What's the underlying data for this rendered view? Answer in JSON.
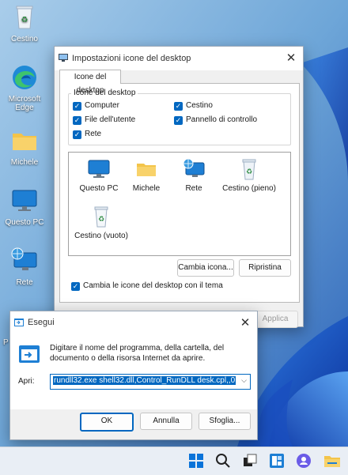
{
  "colors": {
    "accent": "#0067c0",
    "desktop_bg": "#7fb0da",
    "taskbar_bg": "#e9eef5"
  },
  "desktop": {
    "icons": [
      {
        "label": "Cestino",
        "icon": "recycle-bin-icon"
      },
      {
        "label": "Microsoft Edge",
        "icon": "edge-icon"
      },
      {
        "label": "Michele",
        "icon": "user-folder-icon"
      },
      {
        "label": "Questo PC",
        "icon": "computer-icon"
      },
      {
        "label": "Rete",
        "icon": "network-icon"
      },
      {
        "label": "P",
        "icon": "partial-icon"
      }
    ]
  },
  "desktop_icons_dialog": {
    "title": "Impostazioni icone del desktop",
    "tab": "Icone del desktop",
    "group_label": "Icone del desktop",
    "checkboxes": [
      {
        "label": "Computer",
        "checked": true
      },
      {
        "label": "Cestino",
        "checked": true
      },
      {
        "label": "File dell'utente",
        "checked": true
      },
      {
        "label": "Pannello di controllo",
        "checked": true
      },
      {
        "label": "Rete",
        "checked": true
      }
    ],
    "icon_list": [
      {
        "label": "Questo PC",
        "icon": "computer-icon"
      },
      {
        "label": "Michele",
        "icon": "user-folder-icon"
      },
      {
        "label": "Rete",
        "icon": "network-icon"
      },
      {
        "label": "Cestino (pieno)",
        "icon": "recycle-bin-full-icon"
      },
      {
        "label": "Cestino (vuoto)",
        "icon": "recycle-bin-empty-icon"
      }
    ],
    "change_icon_button": "Cambia icona...",
    "restore_button": "Ripristina",
    "theme_checkbox": {
      "label": "Cambia le icone del desktop con il tema",
      "checked": true
    },
    "apply_button": "Applica"
  },
  "run_dialog": {
    "title": "Esegui",
    "description": "Digitare il nome del programma, della cartella, del documento o della risorsa Internet da aprire.",
    "open_label": "Apri:",
    "command_value": "rundll32.exe shell32.dll,Control_RunDLL desk.cpl,,0",
    "ok_button": "OK",
    "cancel_button": "Annulla",
    "browse_button": "Sfoglia..."
  },
  "taskbar": {
    "items": [
      "start-icon",
      "search-icon",
      "task-view-icon",
      "widgets-icon",
      "chat-icon",
      "file-explorer-icon"
    ]
  }
}
